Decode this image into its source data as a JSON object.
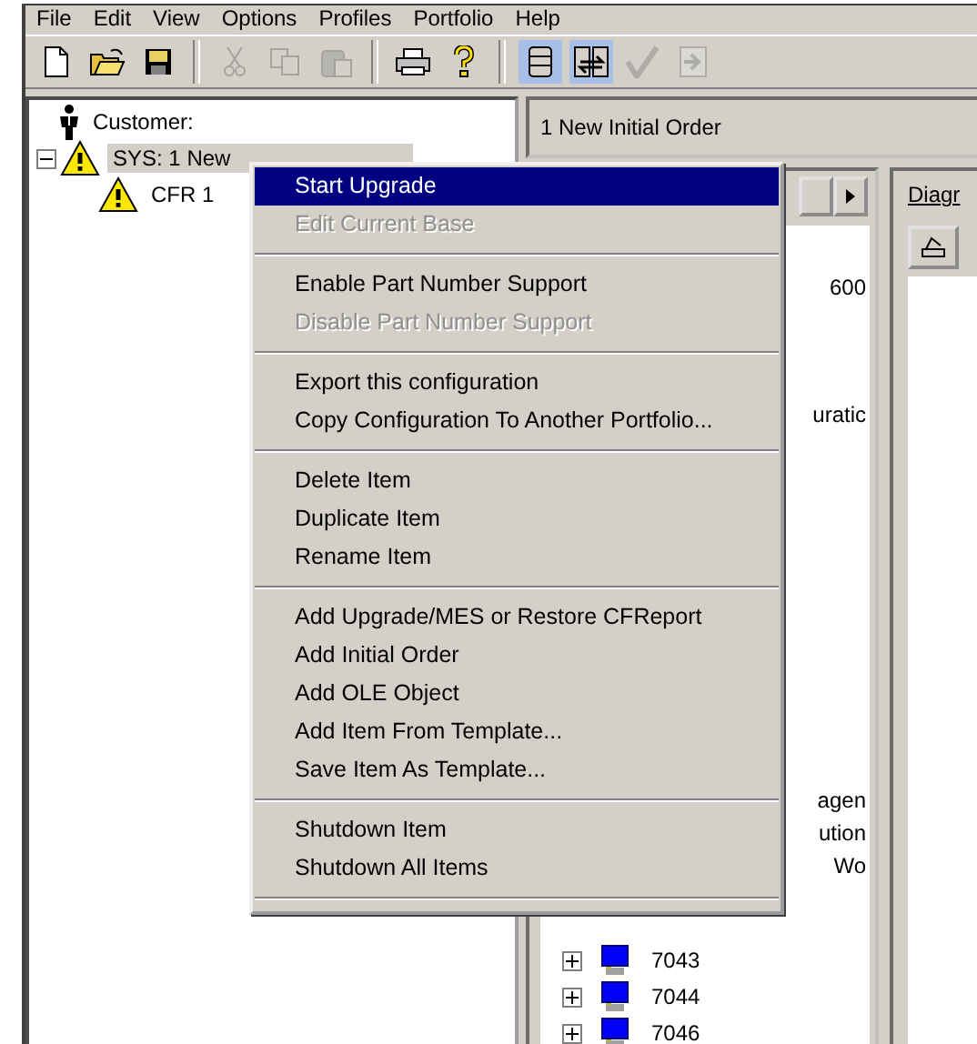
{
  "menu_bar": [
    "File",
    "Edit",
    "View",
    "Options",
    "Profiles",
    "Portfolio",
    "Help"
  ],
  "toolbar": [
    {
      "kind": "new",
      "disabled": false,
      "selected": false
    },
    {
      "kind": "open",
      "disabled": false,
      "selected": false
    },
    {
      "kind": "save",
      "disabled": false,
      "selected": false
    },
    {
      "kind": "separator"
    },
    {
      "kind": "cut",
      "disabled": true,
      "selected": false
    },
    {
      "kind": "copy",
      "disabled": true,
      "selected": false
    },
    {
      "kind": "paste",
      "disabled": true,
      "selected": false
    },
    {
      "kind": "separator"
    },
    {
      "kind": "print",
      "disabled": false,
      "selected": false
    },
    {
      "kind": "help",
      "disabled": false,
      "selected": false
    },
    {
      "kind": "separator"
    },
    {
      "kind": "database",
      "disabled": false,
      "selected": true
    },
    {
      "kind": "swap",
      "disabled": false,
      "selected": true
    },
    {
      "kind": "check",
      "disabled": true,
      "selected": false
    },
    {
      "kind": "export",
      "disabled": true,
      "selected": false
    }
  ],
  "tree": [
    {
      "label": "Customer:",
      "kind": "person",
      "selected": false
    },
    {
      "label": "SYS: 1 New",
      "kind": "warning",
      "selected": true,
      "expanded": true,
      "children": [
        {
          "label": "CFR 1",
          "kind": "warning",
          "selected": false
        }
      ]
    }
  ],
  "panel": {
    "title": "1 New Initial Order",
    "list_fragments": [
      "600",
      "uratic",
      "agen",
      "ution",
      "Wo"
    ],
    "list_nodes": [
      {
        "label": "7043",
        "expanded": false
      },
      {
        "label": "7044",
        "expanded": false
      },
      {
        "label": "7046",
        "expanded": false
      }
    ],
    "diagram_tab": "Diagr"
  },
  "context_menu": [
    {
      "kind": "item",
      "label": "Start Upgrade",
      "disabled": false,
      "selected": true
    },
    {
      "kind": "item",
      "label": "Edit Current Base",
      "disabled": true,
      "selected": false
    },
    {
      "kind": "separator"
    },
    {
      "kind": "item",
      "label": "Enable Part Number Support",
      "disabled": false,
      "selected": false
    },
    {
      "kind": "item",
      "label": "Disable Part Number Support",
      "disabled": true,
      "selected": false
    },
    {
      "kind": "separator"
    },
    {
      "kind": "item",
      "label": "Export this configuration",
      "disabled": false,
      "selected": false
    },
    {
      "kind": "item",
      "label": "Copy Configuration To Another Portfolio...",
      "disabled": false,
      "selected": false
    },
    {
      "kind": "separator"
    },
    {
      "kind": "item",
      "label": "Delete Item",
      "disabled": false,
      "selected": false
    },
    {
      "kind": "item",
      "label": "Duplicate Item",
      "disabled": false,
      "selected": false
    },
    {
      "kind": "item",
      "label": "Rename Item",
      "disabled": false,
      "selected": false
    },
    {
      "kind": "separator"
    },
    {
      "kind": "item",
      "label": "Add Upgrade/MES or Restore CFReport",
      "disabled": false,
      "selected": false
    },
    {
      "kind": "item",
      "label": "Add Initial Order",
      "disabled": false,
      "selected": false
    },
    {
      "kind": "item",
      "label": "Add OLE Object",
      "disabled": false,
      "selected": false
    },
    {
      "kind": "item",
      "label": "Add Item From Template...",
      "disabled": false,
      "selected": false
    },
    {
      "kind": "item",
      "label": "Save Item As Template...",
      "disabled": false,
      "selected": false
    },
    {
      "kind": "separator"
    },
    {
      "kind": "item",
      "label": "Shutdown Item",
      "disabled": false,
      "selected": false
    },
    {
      "kind": "item",
      "label": "Shutdown All Items",
      "disabled": false,
      "selected": false
    },
    {
      "kind": "separator"
    }
  ]
}
